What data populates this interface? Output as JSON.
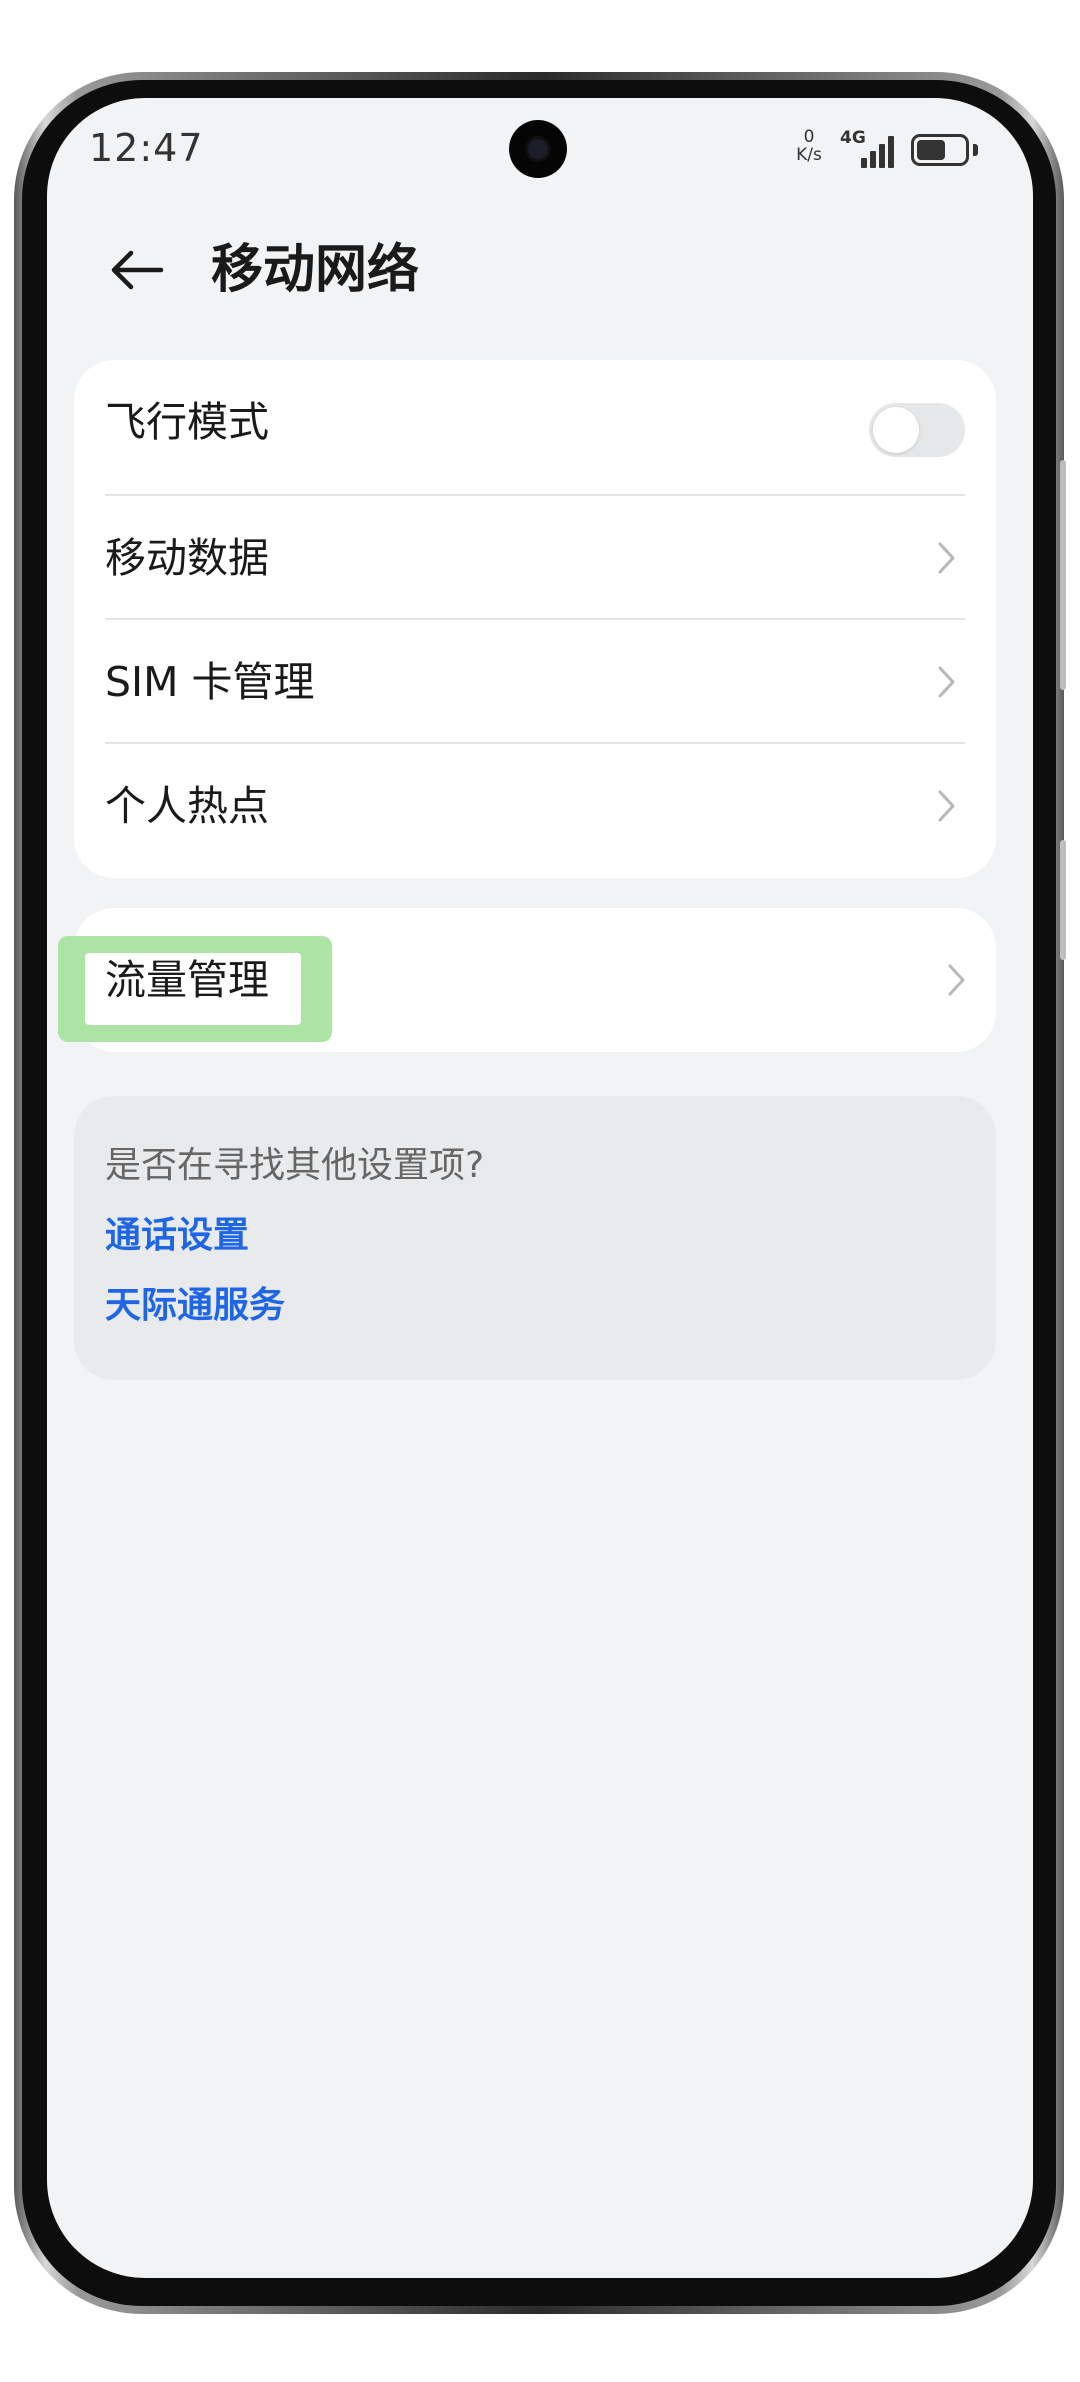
{
  "status_bar": {
    "time": "12:47",
    "net_speed_value": "0",
    "net_speed_unit": "K/s",
    "network_type": "4G",
    "signal_level": 4,
    "battery_level": 0.6
  },
  "header": {
    "title": "移动网络"
  },
  "group1": {
    "items": [
      {
        "label": "飞行模式",
        "control": "toggle",
        "toggle_on": false
      },
      {
        "label": "移动数据",
        "control": "chevron"
      },
      {
        "label": "SIM 卡管理",
        "control": "chevron"
      },
      {
        "label": "个人热点",
        "control": "chevron"
      }
    ]
  },
  "group2": {
    "items": [
      {
        "label": "流量管理",
        "control": "chevron",
        "highlighted": true
      }
    ]
  },
  "suggestions": {
    "question": "是否在寻找其他设置项?",
    "links": [
      "通话设置",
      "天际通服务"
    ]
  },
  "colors": {
    "link": "#1f66e6",
    "highlight": "#a9e3a2",
    "background": "#f1f3f5"
  }
}
